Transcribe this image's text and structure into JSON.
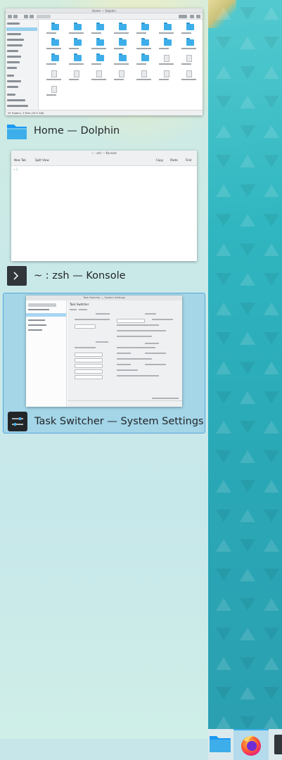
{
  "switcher": {
    "items": [
      {
        "caption": "Home — Dolphin",
        "app": "dolphin",
        "icon": "folder-icon",
        "selected": false,
        "thumb": {
          "title": "Home — Dolphin",
          "status": "29 Folders, 3 Files (29.5 GiB)"
        }
      },
      {
        "caption": "~ : zsh — Konsole",
        "app": "konsole",
        "icon": "terminal-icon",
        "selected": false,
        "thumb": {
          "title": "~ : zsh — Konsole",
          "new_tab": "New Tab",
          "split_view": "Split View",
          "copy": "Copy",
          "paste": "Paste",
          "find": "Find"
        }
      },
      {
        "caption": "Task Switcher — System Settings",
        "app": "systemsettings",
        "icon": "settings-sliders-icon",
        "selected": true,
        "thumb": {
          "title": "Task Switcher — System Settings",
          "header": "Task Switcher"
        }
      }
    ]
  },
  "taskbar": {
    "tasks": [
      "folder-icon",
      "firefox-icon",
      "terminal-icon"
    ]
  },
  "colors": {
    "accent": "#3daee9",
    "selection_border": "#5aa6dc",
    "wallpaper": "#30b6c0"
  }
}
